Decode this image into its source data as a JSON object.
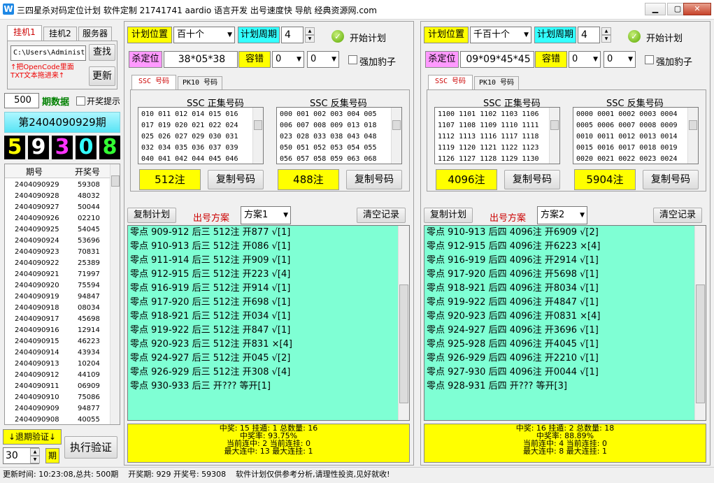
{
  "window": {
    "title": "三四星杀对码定位计划 软件定制 21741741 aardio 语言开发 出号速度快 导航 经典资源网.com",
    "icon": "W"
  },
  "left": {
    "tabs": [
      "挂机1",
      "挂机2",
      "服务器"
    ],
    "path_value": "C:\\Users\\Administ",
    "find_label": "查找",
    "update_label": "更新",
    "hint_line1": "↑把OpenCode里面",
    "hint_line2": "TXT文本拖进来↑",
    "period_count": "500",
    "period_label": "期数据",
    "prize_tip": "开奖提示",
    "current_period": "第2404090929期",
    "digits": [
      {
        "d": "5",
        "color": "#ffff00"
      },
      {
        "d": "9",
        "color": "#ffffff"
      },
      {
        "d": "3",
        "color": "#ff33ff"
      },
      {
        "d": "0",
        "color": "#33ffff"
      },
      {
        "d": "8",
        "color": "#33ff33"
      }
    ],
    "history_headers": [
      "期号",
      "开奖号"
    ],
    "history": [
      [
        "2404090929",
        "59308"
      ],
      [
        "2404090928",
        "48032"
      ],
      [
        "2404090927",
        "50044"
      ],
      [
        "2404090926",
        "02210"
      ],
      [
        "2404090925",
        "54045"
      ],
      [
        "2404090924",
        "53696"
      ],
      [
        "2404090923",
        "70831"
      ],
      [
        "2404090922",
        "25389"
      ],
      [
        "2404090921",
        "71997"
      ],
      [
        "2404090920",
        "75594"
      ],
      [
        "2404090919",
        "94847"
      ],
      [
        "2404090918",
        "08034"
      ],
      [
        "2404090917",
        "45698"
      ],
      [
        "2404090916",
        "12914"
      ],
      [
        "2404090915",
        "46223"
      ],
      [
        "2404090914",
        "43934"
      ],
      [
        "2404090913",
        "10204"
      ],
      [
        "2404090912",
        "44109"
      ],
      [
        "2404090911",
        "06909"
      ],
      [
        "2404090910",
        "75086"
      ],
      [
        "2404090909",
        "94877"
      ],
      [
        "2404090908",
        "40055"
      ]
    ],
    "backtest_label": "↓退期验证↓",
    "backtest_value": "30",
    "backtest_unit": "期",
    "execute_label": "执行验证"
  },
  "plans": [
    {
      "pos_label": "计划位置",
      "pos_value": "百十个",
      "cycle_label": "计划周期",
      "cycle_value": "4",
      "start_label": "开始计划",
      "kill_label": "杀定位",
      "kill_value": "38*05*38",
      "tol_label": "容错",
      "tol1": "0",
      "tol2": "0",
      "leopard_label": "强加豹子",
      "tabs": [
        "SSC 号码",
        "PK10 号码"
      ],
      "pos_title": "SSC 正集号码",
      "neg_title": "SSC 反集号码",
      "pos_numbers": [
        "010 011 012 014 015 016",
        "017 019 020 021 022 024",
        "025 026 027 029 030 031",
        "032 034 035 036 037 039",
        "040 041 042 044 045 046"
      ],
      "neg_numbers": [
        "000 001 002 003 004 005",
        "006 007 008 009 013 018",
        "023 028 033 038 043 048",
        "050 051 052 053 054 055",
        "056 057 058 059 063 068"
      ],
      "pos_count": "512注",
      "neg_count": "488注",
      "copy_label": "复制号码",
      "copy_plan_label": "复制计划",
      "scheme_label": "出号方案",
      "scheme_value": "方案1",
      "clear_label": "清空记录",
      "log": [
        "零点 909-912 后三 512注 开877 √[1]",
        "零点 910-913 后三 512注 开086 √[1]",
        "零点 911-914 后三 512注 开909 √[1]",
        "零点 912-915 后三 512注 开223 √[4]",
        "零点 916-919 后三 512注 开914 √[1]",
        "零点 917-920 后三 512注 开698 √[1]",
        "零点 918-921 后三 512注 开034 √[1]",
        "零点 919-922 后三 512注 开847 √[1]",
        "零点 920-923 后三 512注 开831 ×[4]",
        "零点 924-927 后三 512注 开045 √[2]",
        "零点 926-929 后三 512注 开308 √[4]",
        "零点 930-933 后三 开???  等开[1]"
      ],
      "stats": [
        "中奖: 15  挂遁: 1  总数量: 16",
        "中奖率: 93.75%",
        "当前连中: 2  当前连挂: 0",
        "最大连中: 13  最大连挂: 1"
      ]
    },
    {
      "pos_label": "计划位置",
      "pos_value": "千百十个",
      "cycle_label": "计划周期",
      "cycle_value": "4",
      "start_label": "开始计划",
      "kill_label": "杀定位",
      "kill_value": "09*09*45*45",
      "tol_label": "容错",
      "tol1": "0",
      "tol2": "0",
      "leopard_label": "强加豹子",
      "tabs": [
        "SSC 号码",
        "PK10 号码"
      ],
      "pos_title": "SSC 正集号码",
      "neg_title": "SSC 反集号码",
      "pos_numbers": [
        "1100 1101 1102 1103 1106",
        "1107 1108 1109 1110 1111",
        "1112 1113 1116 1117 1118",
        "1119 1120 1121 1122 1123",
        "1126 1127 1128 1129 1130"
      ],
      "neg_numbers": [
        "0000 0001 0002 0003 0004",
        "0005 0006 0007 0008 0009",
        "0010 0011 0012 0013 0014",
        "0015 0016 0017 0018 0019",
        "0020 0021 0022 0023 0024"
      ],
      "pos_count": "4096注",
      "neg_count": "5904注",
      "copy_label": "复制号码",
      "copy_plan_label": "复制计划",
      "scheme_label": "出号方案",
      "scheme_value": "方案2",
      "clear_label": "清空记录",
      "log": [
        "零点 910-913 后四 4096注 开6909 √[2]",
        "零点 912-915 后四 4096注 开6223 ×[4]",
        "零点 916-919 后四 4096注 开2914 √[1]",
        "零点 917-920 后四 4096注 开5698 √[1]",
        "零点 918-921 后四 4096注 开8034 √[1]",
        "零点 919-922 后四 4096注 开4847 √[1]",
        "零点 920-923 后四 4096注 开0831 ×[4]",
        "零点 924-927 后四 4096注 开3696 √[1]",
        "零点 925-928 后四 4096注 开4045 √[1]",
        "零点 926-929 后四 4096注 开2210 √[1]",
        "零点 927-930 后四 4096注 开0044 √[1]",
        "零点 928-931 后四 开???  等开[3]"
      ],
      "stats": [
        "中奖: 16  挂遁: 2  总数量: 18",
        "中奖率: 88.89%",
        "当前连中: 4  当前连挂: 0",
        "最大连中: 8  最大连挂: 1"
      ]
    }
  ],
  "status": "更新时间: 10:23:08,总共: 500期    开奖期: 929 开奖号: 59308    软件计划仅供参考分析,请理性投资,见好就收!",
  "colors": {
    "log_bg": "#7fffd4",
    "accent_yellow": "#ffff00",
    "accent_cyan": "#33ffff",
    "accent_pink": "#ff99ff",
    "title_red": "#cc0000"
  }
}
